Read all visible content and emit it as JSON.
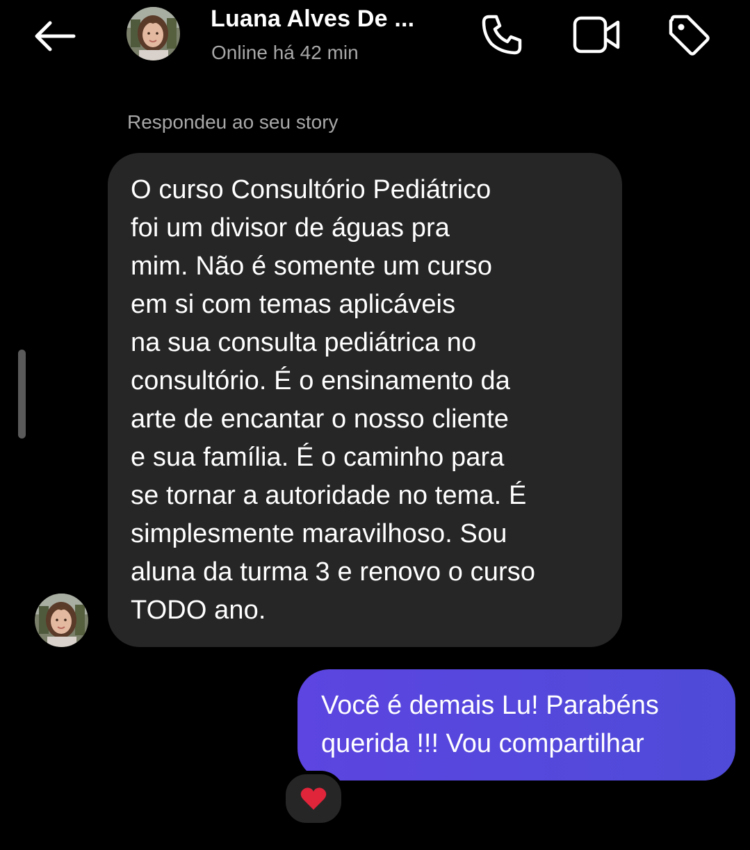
{
  "header": {
    "back_icon": "arrow-left-icon",
    "contact_name": "Luana Alves De ...",
    "status": "Online há 42 min",
    "call_icon": "phone-icon",
    "video_icon": "video-camera-icon",
    "tag_icon": "tag-icon"
  },
  "conversation": {
    "story_reply_label": "Respondeu ao seu story",
    "incoming_message": "O curso Consultório Pediátrico\nfoi um divisor de águas pra\nmim. Não é somente um curso\nem si com temas aplicáveis\nna sua consulta pediátrica no\nconsultório. É o ensinamento da\narte de encantar o nosso cliente\ne sua família. É o caminho para\nse tornar a autoridade no tema. É\nsimplesmente maravilhoso. Sou\naluna da turma 3 e renovo o curso\nTODO ano.",
    "outgoing_message": "Você é demais Lu! Parabéns\nquerida !!! Vou compartilhar",
    "reaction": "❤️"
  },
  "colors": {
    "background": "#000000",
    "incoming_bubble": "#262626",
    "outgoing_bubble": "#5a47de",
    "secondary_text": "#a8a8a8"
  }
}
